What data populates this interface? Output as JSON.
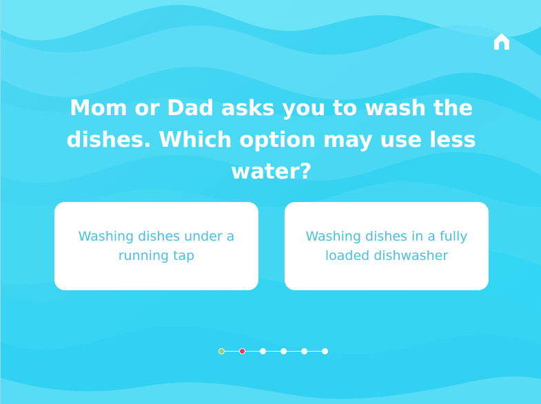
{
  "question": {
    "text": "Mom or Dad asks you to wash the dishes. Which option may use less water?"
  },
  "answers": [
    {
      "label": "Washing dishes under a running tap"
    },
    {
      "label": "Washing dishes in a fully loaded dishwasher"
    }
  ],
  "navigation": {
    "home_icon": "home-icon"
  },
  "progress": {
    "total_steps": 6,
    "current_step": 2,
    "colors": {
      "completed": "#8fd35a",
      "current": "#ef3b46",
      "upcoming": "#ffffff"
    }
  },
  "theme": {
    "background": "#3fd6f2",
    "answer_text": "#47bfe0",
    "card_background": "#ffffff"
  }
}
